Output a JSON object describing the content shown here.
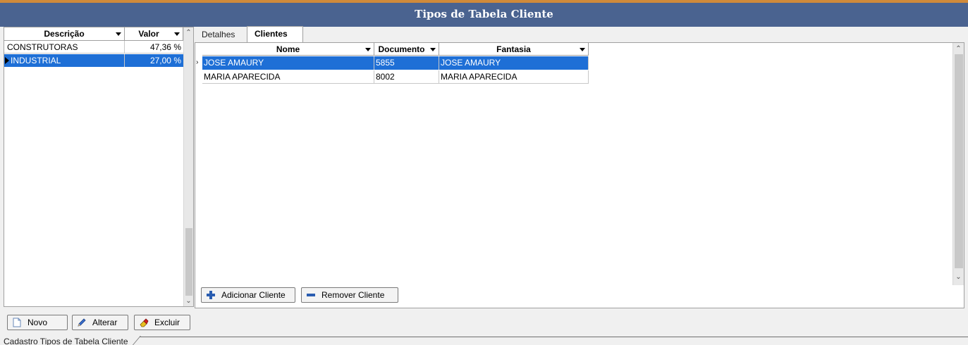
{
  "window": {
    "title": "Tipos de Tabela Cliente"
  },
  "left_grid": {
    "columns": [
      "Descrição",
      "Valor"
    ],
    "rows": [
      {
        "descricao": "CONSTRUTORAS",
        "valor": "47,36 %"
      },
      {
        "descricao": "INDUSTRIAL",
        "valor": "27,00 %"
      }
    ],
    "selected_row": 1
  },
  "tabs": [
    {
      "label": "Detalhes"
    },
    {
      "label": "Clientes"
    }
  ],
  "active_tab": "Clientes",
  "clients_grid": {
    "columns": [
      "Nome",
      "Documento",
      "Fantasia"
    ],
    "rows": [
      {
        "nome": "JOSE AMAURY",
        "documento": "5855",
        "fantasia": "JOSE AMAURY"
      },
      {
        "nome": "MARIA APARECIDA",
        "documento": "8002",
        "fantasia": "MARIA APARECIDA"
      }
    ],
    "selected_row": 0
  },
  "client_buttons": {
    "add": "Adicionar Cliente",
    "remove": "Remover Cliente"
  },
  "bottom_buttons": {
    "new": "Novo",
    "edit": "Alterar",
    "delete": "Excluir"
  },
  "status_tab": {
    "label": "Cadastro Tipos de Tabela Cliente"
  },
  "colors": {
    "title_bar": "#4a6390",
    "selection": "#1e6fd6"
  }
}
